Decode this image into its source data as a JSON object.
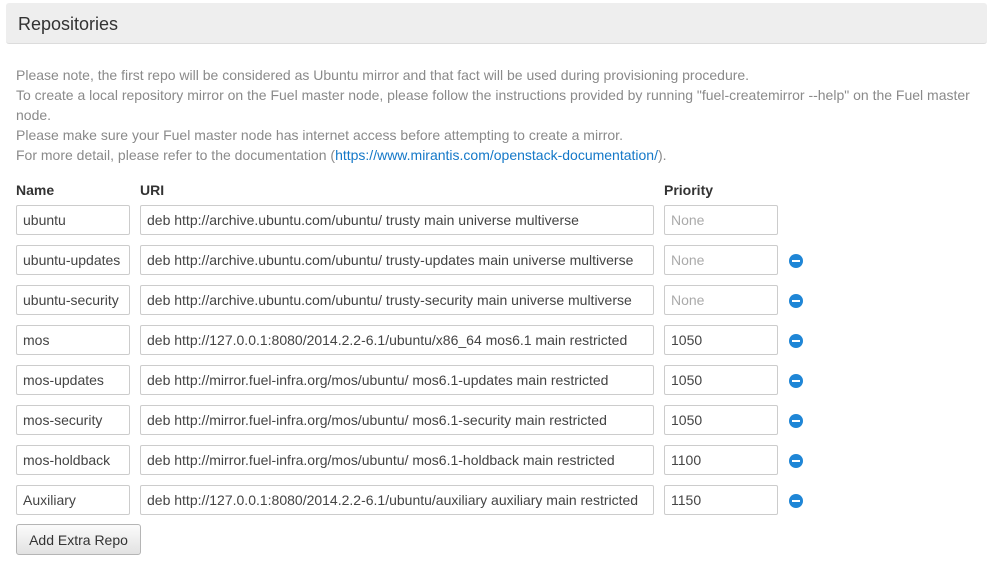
{
  "section": {
    "title": "Repositories"
  },
  "notes": {
    "line1": "Please note, the first repo will be considered as Ubuntu mirror and that fact will be used during provisioning procedure.",
    "line2": "To create a local repository mirror on the Fuel master node, please follow the instructions provided by running \"fuel-createmirror --help\" on the Fuel master node.",
    "line3": "Please make sure your Fuel master node has internet access before attempting to create a mirror.",
    "line4_prefix": "For more detail, please refer to the documentation (",
    "line4_link": "https://www.mirantis.com/openstack-documentation/",
    "line4_suffix": ")."
  },
  "columns": {
    "name": "Name",
    "uri": "URI",
    "priority": "Priority"
  },
  "repos": [
    {
      "name": "ubuntu",
      "uri": "deb http://archive.ubuntu.com/ubuntu/ trusty main universe multiverse",
      "priority": "",
      "priority_placeholder": "None"
    },
    {
      "name": "ubuntu-updates",
      "uri": "deb http://archive.ubuntu.com/ubuntu/ trusty-updates main universe multiverse",
      "priority": "",
      "priority_placeholder": "None"
    },
    {
      "name": "ubuntu-security",
      "uri": "deb http://archive.ubuntu.com/ubuntu/ trusty-security main universe multiverse",
      "priority": "",
      "priority_placeholder": "None"
    },
    {
      "name": "mos",
      "uri": "deb http://127.0.0.1:8080/2014.2.2-6.1/ubuntu/x86_64 mos6.1 main restricted",
      "priority": "1050",
      "priority_placeholder": ""
    },
    {
      "name": "mos-updates",
      "uri": "deb http://mirror.fuel-infra.org/mos/ubuntu/ mos6.1-updates main restricted",
      "priority": "1050",
      "priority_placeholder": ""
    },
    {
      "name": "mos-security",
      "uri": "deb http://mirror.fuel-infra.org/mos/ubuntu/ mos6.1-security main restricted",
      "priority": "1050",
      "priority_placeholder": ""
    },
    {
      "name": "mos-holdback",
      "uri": "deb http://mirror.fuel-infra.org/mos/ubuntu/ mos6.1-holdback main restricted",
      "priority": "1100",
      "priority_placeholder": ""
    },
    {
      "name": "Auxiliary",
      "uri": "deb http://127.0.0.1:8080/2014.2.2-6.1/ubuntu/auxiliary auxiliary main restricted",
      "priority": "1150",
      "priority_placeholder": ""
    }
  ],
  "add_button": {
    "label": "Add Extra Repo"
  },
  "colors": {
    "link": "#1478c8",
    "remove_icon": "#1f86d6",
    "note_text": "#8a8a8a",
    "header_bg": "#eeeeee"
  },
  "icons": {
    "remove": "minus-circle-icon"
  }
}
